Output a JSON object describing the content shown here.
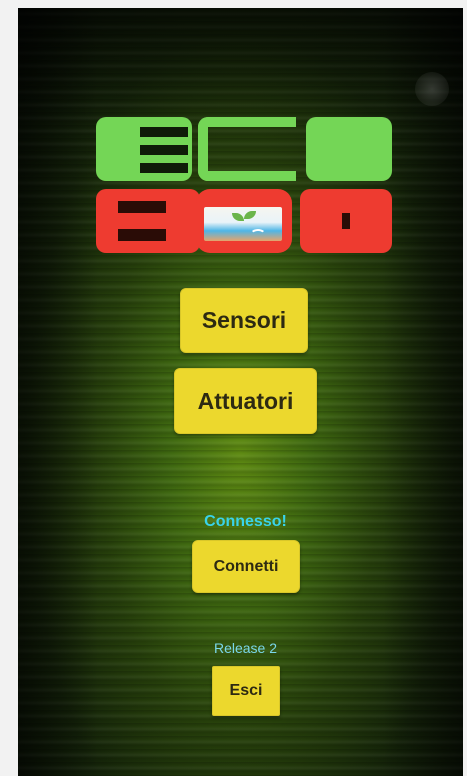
{
  "app": {
    "logo_icon": "ecobox-logo-icon",
    "colors": {
      "logo_green": "#74d656",
      "logo_red": "#ee3b30",
      "button_yellow": "#ecd82d",
      "status_cyan": "#39d3ea"
    }
  },
  "buttons": {
    "sensori": "Sensori",
    "attuatori": "Attuatori",
    "connetti": "Connetti",
    "esci": "Esci"
  },
  "status": {
    "connection": "Connesso!"
  },
  "footer": {
    "release": "Release 2"
  }
}
